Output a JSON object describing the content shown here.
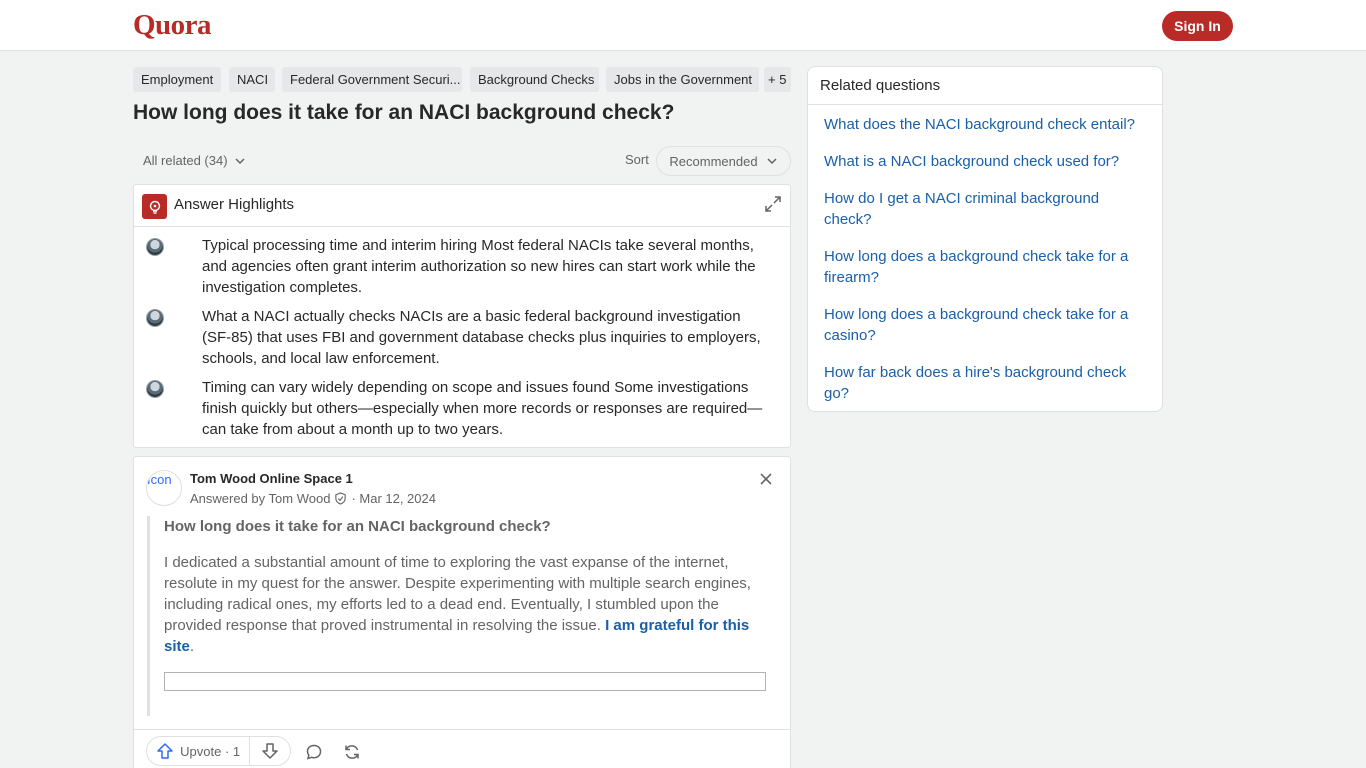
{
  "header": {
    "logo": "Quora",
    "signin_label": "Sign In"
  },
  "topics": [
    "Employment",
    "NACI",
    "Federal Government Securi...",
    "Background Checks",
    "Jobs in the Government",
    "+ 5"
  ],
  "question": {
    "title": "How long does it take for an NACI background check?"
  },
  "filters": {
    "all_related": "All related (34)",
    "sort_label": "Sort",
    "sort_value": "Recommended"
  },
  "highlights": {
    "title": "Answer Highlights",
    "items": [
      "Typical processing time and interim hiring Most federal NACIs take several months, and agencies often grant interim authorization so new hires can start work while the investigation completes.",
      "What a NACI actually checks NACIs are a basic federal background investigation (SF-85) that uses FBI and government database checks plus inquiries to employers, schools, and local law enforcement.",
      "Timing can vary widely depending on scope and issues found Some investigations finish quickly but others—especially when more records or responses are required—can take from about a month up to two years."
    ]
  },
  "answer": {
    "avatar_alt": "Icon",
    "space_name": "Tom Wood Online Space 1",
    "answered_by": "Answered by Tom Wood",
    "date": "· Mar 12, 2024",
    "quote_title": "How long does it take for an NACI background check?",
    "body": "I dedicated a substantial amount of time to exploring the vast expanse of the internet, resolute in my quest for the answer. Despite experimenting with multiple search engines, including radical ones, my efforts led to a dead end. Eventually, I stumbled upon the provided response that proved instrumental in resolving the issue.",
    "link_text": "I am grateful for this site",
    "link_suffix": ".",
    "upvote_label": "Upvote · 1"
  },
  "related": {
    "title": "Related questions",
    "items": [
      "What does the NACI background check entail?",
      "What is a NACI background check used for?",
      "How do I get a NACI criminal background check?",
      "How long does a background check take for a firearm?",
      "How long does a background check take for a casino?",
      "How far back does a hire's background check go?"
    ]
  },
  "colors": {
    "brand": "#b92b27",
    "link": "#195faa",
    "background": "#f1f2f2"
  }
}
